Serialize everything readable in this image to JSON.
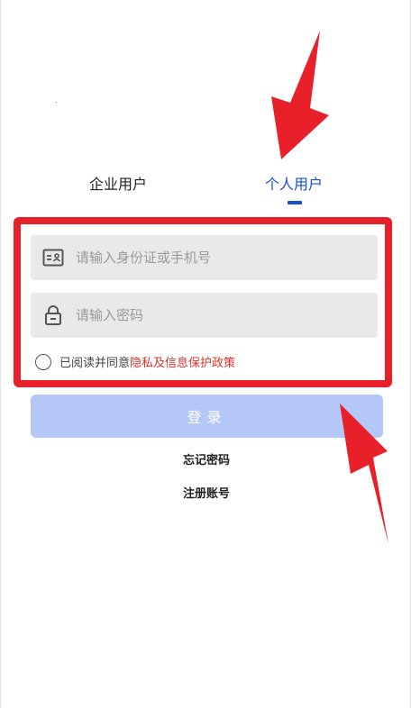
{
  "tabs": {
    "enterprise": "企业用户",
    "personal": "个人用户",
    "active": "personal"
  },
  "form": {
    "id_placeholder": "请输入身份证或手机号",
    "password_placeholder": "请输入密码"
  },
  "agreement": {
    "prefix": "已阅读并同意",
    "link": "隐私及信息保护政策"
  },
  "actions": {
    "login": "登录",
    "forgot": "忘记密码",
    "register": "注册账号"
  },
  "colors": {
    "accent": "#1a4fd0",
    "highlight": "#e8202a",
    "login_button": "#b5c7f7",
    "link": "#d9332b",
    "field_bg": "#e9e9e9"
  },
  "icons": {
    "id_field": "id-card-icon",
    "password_field": "lock-icon"
  }
}
